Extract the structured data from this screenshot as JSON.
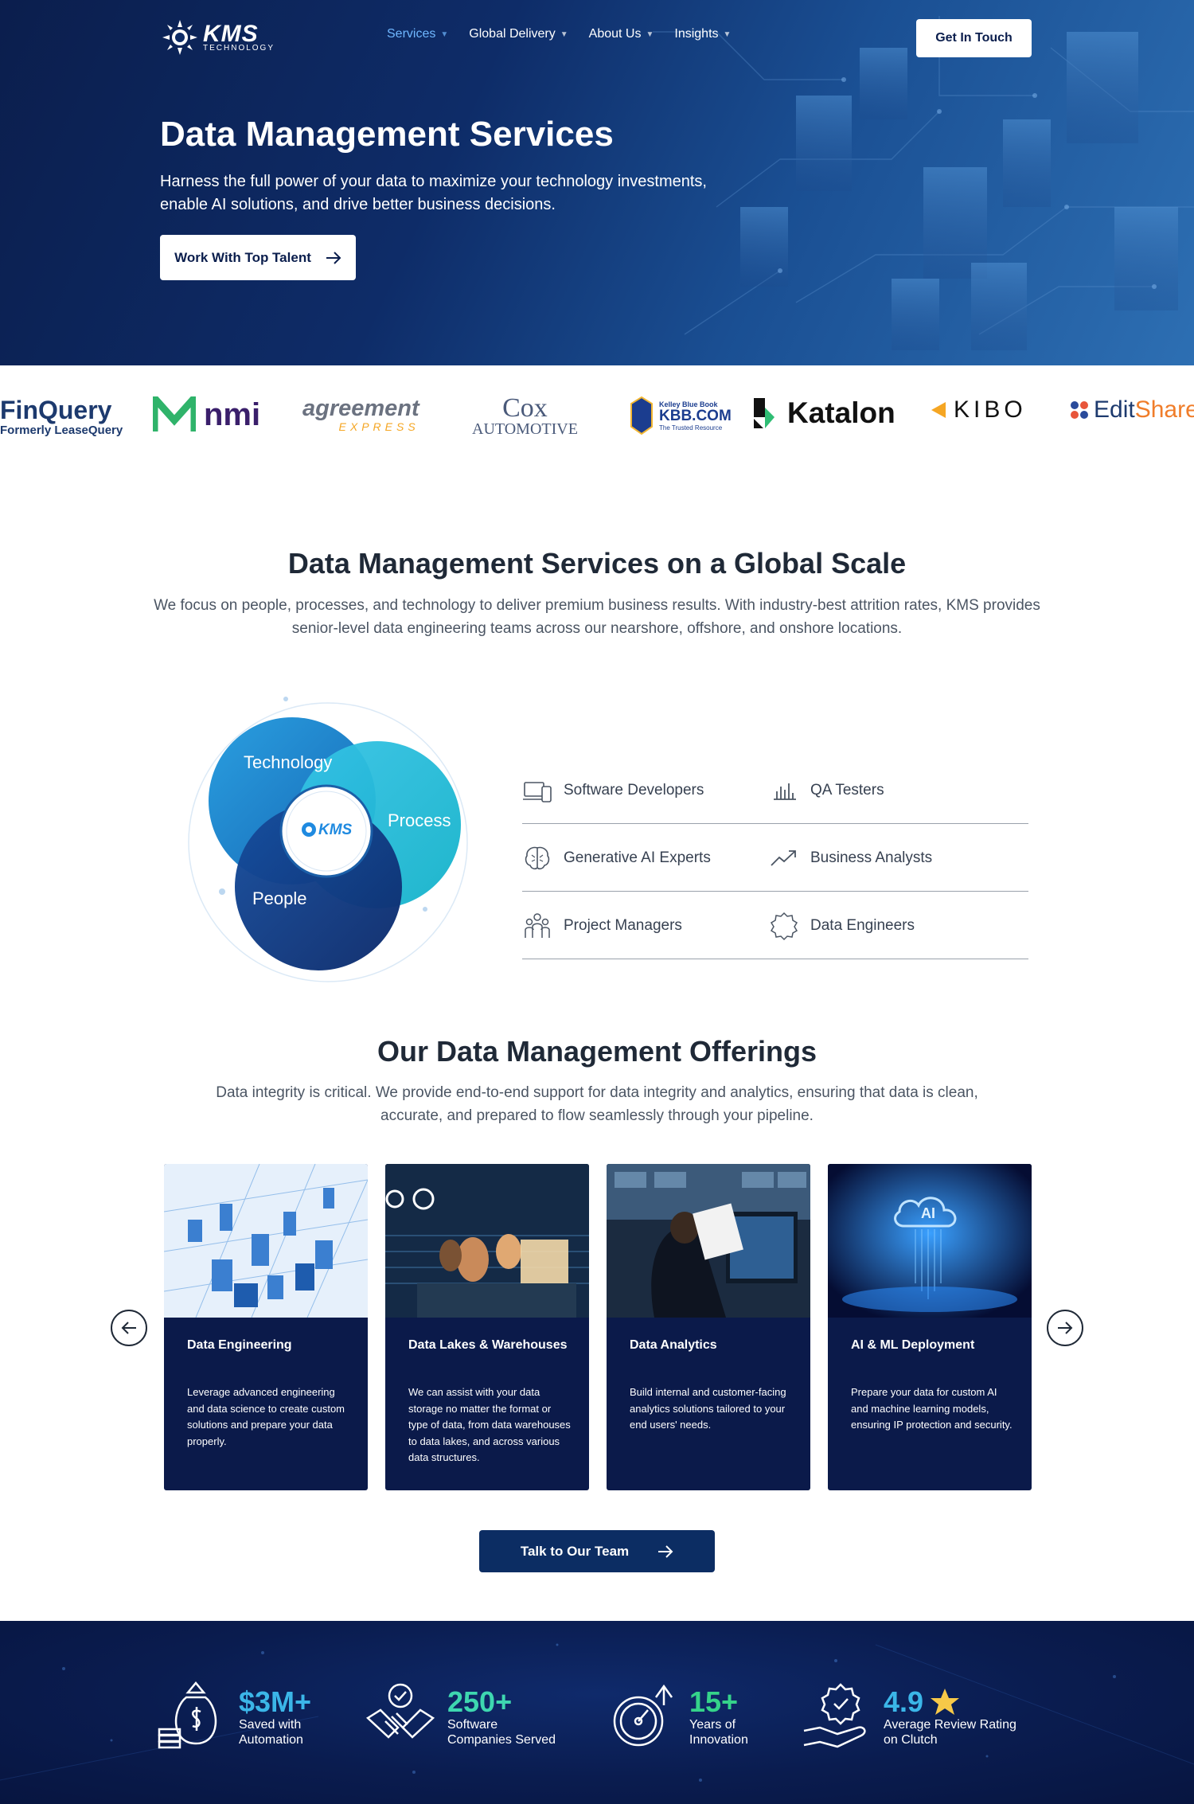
{
  "brand": {
    "name": "KMS",
    "sub": "TECHNOLOGY"
  },
  "nav": {
    "items": [
      {
        "label": "Services"
      },
      {
        "label": "Global Delivery"
      },
      {
        "label": "About Us"
      },
      {
        "label": "Insights"
      }
    ],
    "cta": "Get In Touch"
  },
  "hero": {
    "title": "Data Management Services",
    "subtitle": "Harness the full power of your data to maximize your technology investments, enable AI solutions, and drive better business decisions.",
    "cta": "Work With Top Talent"
  },
  "clients": {
    "finquery": {
      "name": "FinQuery",
      "sub": "Formerly LeaseQuery"
    },
    "nmi": {
      "name": "nmi"
    },
    "agreement": {
      "name": "agreement",
      "sub": "EXPRESS"
    },
    "cox": {
      "name": "Cox",
      "sub": "AUTOMOTIVE"
    },
    "kbb": {
      "top": "Kelley Blue Book",
      "name": "KBB.COM",
      "sub": "The Trusted Resource"
    },
    "katalon": {
      "name": "Katalon"
    },
    "kibo": {
      "name": "KIBO"
    },
    "editshare": {
      "name1": "Edit",
      "name2": "Share"
    }
  },
  "global": {
    "title": "Data Management Services on a Global Scale",
    "subtitle": "We focus on people, processes, and technology to deliver premium business results. With industry-best attrition rates, KMS provides senior-level data engineering teams across our nearshore, offshore, and onshore locations.",
    "venn": {
      "technology": "Technology",
      "process": "Process",
      "people": "People"
    },
    "roles": [
      {
        "label": "Software Developers",
        "icon": "laptop-phone-icon"
      },
      {
        "label": "QA Testers",
        "icon": "bar-chart-icon"
      },
      {
        "label": "Generative AI Experts",
        "icon": "brain-icon"
      },
      {
        "label": "Business Analysts",
        "icon": "trend-line-icon"
      },
      {
        "label": "Project Managers",
        "icon": "team-icon"
      },
      {
        "label": "Data Engineers",
        "icon": "puzzle-gear-icon"
      }
    ]
  },
  "offerings": {
    "title": "Our Data Management Offerings",
    "subtitle": "Data integrity is critical. We provide end-to-end support for data integrity and analytics, ensuring that data is clean, accurate, and prepared to flow seamlessly through your pipeline.",
    "cards": [
      {
        "title": "Data Engineering",
        "desc": "Leverage advanced engineering and data science  to create custom solutions and prepare your data properly."
      },
      {
        "title": "Data Lakes & Warehouses",
        "desc": "We can assist with your data storage no matter the format or type of data, from data warehouses to data lakes, and across various data structures."
      },
      {
        "title": "Data Analytics",
        "desc": "Build internal and customer-facing analytics solutions tailored to your end users' needs."
      },
      {
        "title": "AI & ML Deployment",
        "desc": "Prepare your data for custom AI  and machine learning models, ensuring IP protection and security."
      }
    ],
    "card4_badge": "AI",
    "cta": "Talk to Our Team"
  },
  "stats": [
    {
      "value": "$3M+",
      "label1": "Saved with",
      "label2": "Automation",
      "color": "#3bb6e8"
    },
    {
      "value": "250+",
      "label1": "Software",
      "label2": "Companies Served",
      "color": "#3ed7b0"
    },
    {
      "value": "15+",
      "label1": "Years of",
      "label2": "Innovation",
      "color": "#35d38a"
    },
    {
      "value": "4.9",
      "label1": "Average Review Rating",
      "label2": "on Clutch",
      "color": "#3bb6e8"
    }
  ]
}
